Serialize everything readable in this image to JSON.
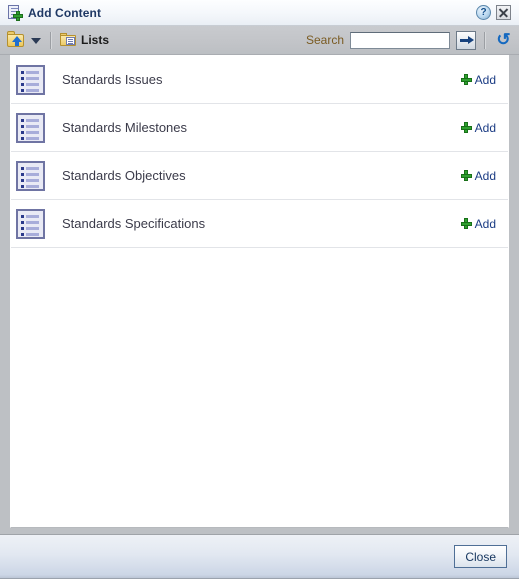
{
  "window": {
    "title": "Add Content",
    "title_icon": "add-content-icon",
    "help_label": "?",
    "help_icon": "help-icon",
    "close_icon": "close-icon"
  },
  "toolbar": {
    "folder_up_icon": "folder-up-icon",
    "dropdown_icon": "chevron-down-icon",
    "breadcrumb": {
      "icon": "lists-folder-icon",
      "label": "Lists"
    },
    "search": {
      "label": "Search",
      "value": "",
      "placeholder": "",
      "go_icon": "arrow-right-icon"
    },
    "refresh_icon": "refresh-icon"
  },
  "content": {
    "row_icon": "list-icon",
    "add_icon": "green-plus-icon",
    "rows": [
      {
        "label": "Standards Issues",
        "action": "Add"
      },
      {
        "label": "Standards Milestones",
        "action": "Add"
      },
      {
        "label": "Standards Objectives",
        "action": "Add"
      },
      {
        "label": "Standards Specifications",
        "action": "Add"
      }
    ]
  },
  "footer": {
    "close_label": "Close"
  },
  "colors": {
    "title_text": "#1f3864",
    "link": "#1b3c84",
    "plus_green": "#2fa02f",
    "search_label": "#7a5b22",
    "row_text": "#3b3b4a",
    "toolbar_bg": "#c3c5c9",
    "body_bg": "#bdc0c4"
  }
}
